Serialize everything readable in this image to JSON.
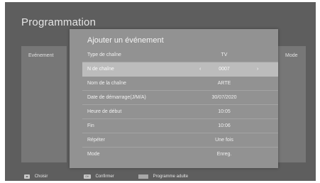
{
  "background": {
    "title": "Programmation",
    "col_left": "Evénement",
    "col_right": "Mode"
  },
  "modal": {
    "title": "Ajouter un événement",
    "rows": [
      {
        "label": "Type de chaîne",
        "value": "TV"
      },
      {
        "label": "N de chaîne",
        "value": "0007",
        "left_arrow": "‹",
        "right_arrow": "›"
      },
      {
        "label": "Nom de la chaîne",
        "value": "ARTE"
      },
      {
        "label": "Date de démarrage(J/M/A)",
        "value": "30/07/2020"
      },
      {
        "label": "Heure de début",
        "value": "10:05"
      },
      {
        "label": "Fin",
        "value": "10:06"
      },
      {
        "label": "Répéter",
        "value": "Une fois"
      },
      {
        "label": "Mode",
        "value": "Enreg."
      }
    ]
  },
  "footer": {
    "choose_key": "◂▸",
    "choose_label": "Choisir",
    "ok_key": "OK",
    "confirm_label": "Confirmer",
    "adult_label": "Programme adulte"
  }
}
